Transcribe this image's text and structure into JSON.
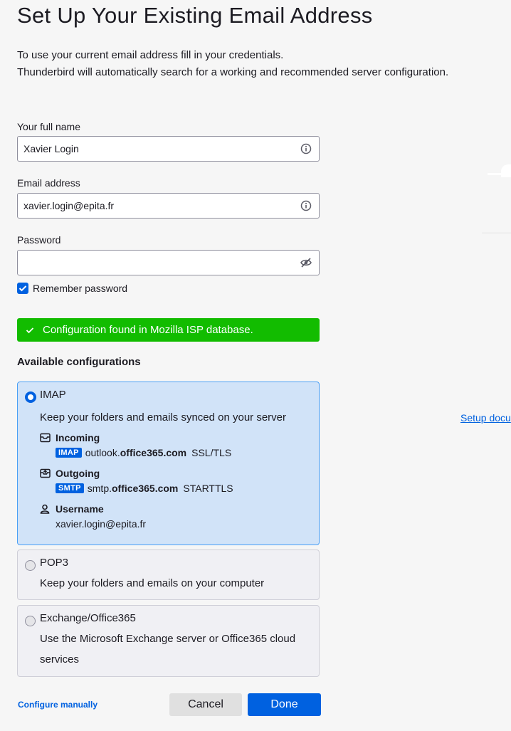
{
  "page": {
    "title": "Set Up Your Existing Email Address",
    "intro_line1": "To use your current email address fill in your credentials.",
    "intro_line2": "Thunderbird will automatically search for a working and recommended server configuration."
  },
  "form": {
    "full_name": {
      "label": "Your full name",
      "value": "Xavier Login",
      "icon": "info-icon"
    },
    "email": {
      "label": "Email address",
      "value": "xavier.login@epita.fr",
      "icon": "info-icon"
    },
    "password": {
      "label": "Password",
      "value": "",
      "icon": "eye-slash-icon"
    },
    "remember_password": {
      "label": "Remember password",
      "checked": true
    }
  },
  "notice": {
    "text": "Configuration found in Mozilla ISP database.",
    "color": "#12bc00",
    "icon": "check-icon"
  },
  "configs": {
    "title": "Available configurations",
    "imap": {
      "name": "IMAP",
      "description": "Keep your folders and emails synced on your server",
      "selected": true,
      "incoming": {
        "label": "Incoming",
        "protocol": "IMAP",
        "host_prefix": "outlook.",
        "host_domain": "office365.com",
        "security": "SSL/TLS"
      },
      "outgoing": {
        "label": "Outgoing",
        "protocol": "SMTP",
        "host_prefix": "smtp.",
        "host_domain": "office365.com",
        "security": "STARTTLS"
      },
      "username": {
        "label": "Username",
        "value": "xavier.login@epita.fr"
      }
    },
    "pop3": {
      "name": "POP3",
      "description": "Keep your folders and emails on your computer",
      "selected": false
    },
    "exchange": {
      "name": "Exchange/Office365",
      "description": "Use the Microsoft Exchange server or Office365 cloud services",
      "selected": false
    }
  },
  "footer": {
    "configure_manually": "Configure manually",
    "cancel": "Cancel",
    "done": "Done"
  },
  "side": {
    "setup_documentation": "Setup docu"
  },
  "colors": {
    "accent": "#0061e0",
    "selected_bg": "#d1e3f8",
    "success": "#12bc00"
  }
}
